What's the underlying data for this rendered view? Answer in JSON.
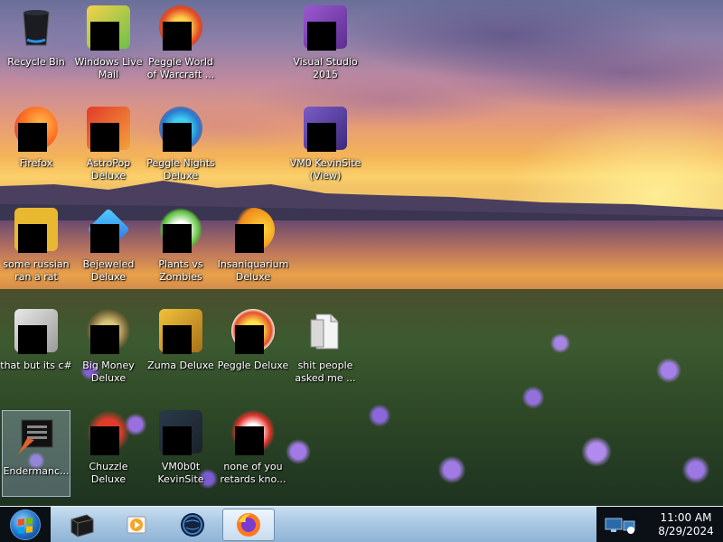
{
  "desktop": {
    "icons": [
      {
        "label": "Recycle Bin",
        "icon": "recycle-bin-icon",
        "redacted": false,
        "selected": false
      },
      {
        "label": "Windows Live\nMail",
        "icon": "windows-live-mail-icon",
        "redacted": true,
        "selected": false
      },
      {
        "label": "Peggle World\nof Warcraft ...",
        "icon": "peggle-wow-icon",
        "redacted": true,
        "selected": false
      },
      {
        "label": "Visual Studio\n2015",
        "icon": "visual-studio-icon",
        "redacted": true,
        "selected": false
      },
      {
        "label": "Firefox",
        "icon": "firefox-icon",
        "redacted": true,
        "selected": false
      },
      {
        "label": "AstroPop\nDeluxe",
        "icon": "astropop-icon",
        "redacted": true,
        "selected": false
      },
      {
        "label": "Peggle Nights\nDeluxe",
        "icon": "peggle-nights-icon",
        "redacted": true,
        "selected": false
      },
      {
        "label": "VM0 KevinSite\n(View)",
        "icon": "visual-studio-project-icon",
        "redacted": true,
        "selected": false
      },
      {
        "label": "some russian\nran a rat",
        "icon": "internet-explorer-icon",
        "redacted": true,
        "selected": false
      },
      {
        "label": "Bejeweled\nDeluxe",
        "icon": "bejeweled-icon",
        "redacted": true,
        "selected": false
      },
      {
        "label": "Plants vs\nZombies",
        "icon": "plants-vs-zombies-icon",
        "redacted": true,
        "selected": false
      },
      {
        "label": "Insaniquarium\nDeluxe",
        "icon": "insaniquarium-icon",
        "redacted": true,
        "selected": false
      },
      {
        "label": "that but its c#",
        "icon": "windows-stack-icon",
        "redacted": true,
        "selected": false
      },
      {
        "label": "Big Money\nDeluxe",
        "icon": "big-money-icon",
        "redacted": true,
        "selected": false
      },
      {
        "label": "Zuma Deluxe",
        "icon": "zuma-icon",
        "redacted": true,
        "selected": false
      },
      {
        "label": "Peggle Deluxe",
        "icon": "peggle-icon",
        "redacted": true,
        "selected": false
      },
      {
        "label": "shit people\nasked me ...",
        "icon": "document-icon",
        "redacted": false,
        "selected": false
      },
      {
        "label": "Endermanc...",
        "icon": "endermanch-icon",
        "redacted": false,
        "selected": true
      },
      {
        "label": "Chuzzle\nDeluxe",
        "icon": "chuzzle-icon",
        "redacted": true,
        "selected": false
      },
      {
        "label": "VM0b0t\nKevinSite",
        "icon": "vm-project-icon",
        "redacted": true,
        "selected": false
      },
      {
        "label": "none of you\nretards kno...",
        "icon": "firefox-icon",
        "redacted": true,
        "selected": false
      }
    ]
  },
  "taskbar": {
    "start_icon": "windows-start-orb-icon",
    "pinned": [
      {
        "name": "terminal-app-icon",
        "active": false
      },
      {
        "name": "media-player-icon",
        "active": false
      },
      {
        "name": "globe-browser-icon",
        "active": false
      },
      {
        "name": "firefox-icon",
        "active": true
      }
    ],
    "tray": {
      "time": "11:00 AM",
      "date": "8/29/2024",
      "icon": "network-computer-icon"
    }
  }
}
